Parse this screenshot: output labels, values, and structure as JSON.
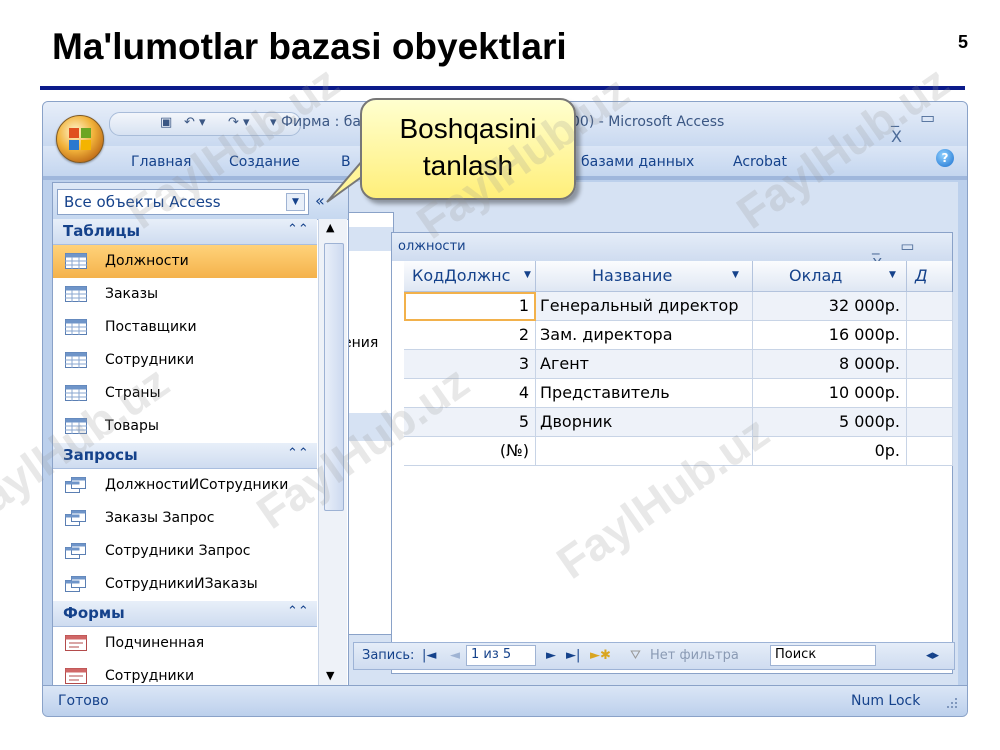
{
  "slide": {
    "title": "Ma'lumotlar bazasi obyektlari",
    "page_number": "5"
  },
  "window": {
    "title_left": "Фирма : ба",
    "title_right": "00) - Microsoft Access",
    "controls": "_ ▭ X",
    "ribbon_tabs": [
      "Главная",
      "Создание",
      "В",
      "базами данных",
      "Acrobat"
    ]
  },
  "nav": {
    "selector": "Все объекты Access",
    "collapse": "«",
    "groups": [
      {
        "label": "Таблицы",
        "items": [
          "Должности",
          "Заказы",
          "Поставщики",
          "Сотрудники",
          "Страны",
          "Товары"
        ]
      },
      {
        "label": "Запросы",
        "items": [
          "ДолжностиИСотрудники",
          "Заказы Запрос",
          "Сотрудники Запрос",
          "СотрудникиИЗаказы"
        ]
      },
      {
        "label": "Формы",
        "items": [
          "Подчиненная",
          "Сотрудники"
        ]
      }
    ],
    "selected_item": "Должности"
  },
  "partial_label": "ения",
  "table": {
    "title": "олжности",
    "columns": [
      "КодДолжнс",
      "Название",
      "Оклад",
      "Д"
    ],
    "rows": [
      [
        "1",
        "Генеральный директор",
        "32 000р."
      ],
      [
        "2",
        "Зам. директора",
        "16 000р."
      ],
      [
        "3",
        "Агент",
        "8 000р."
      ],
      [
        "4",
        "Представитель",
        "10 000р."
      ],
      [
        "5",
        "Дворник",
        "5 000р."
      ],
      [
        "(№)",
        "",
        "0р."
      ]
    ]
  },
  "record_nav": {
    "label": "Запись:",
    "position": "1 из 5",
    "filter": "Нет фильтра",
    "search": "Поиск"
  },
  "status": {
    "left": "Готово",
    "right": "Num Lock"
  },
  "callout": {
    "line1": "Boshqasini",
    "line2": "tanlash"
  },
  "watermark": "FaylHub.uz"
}
